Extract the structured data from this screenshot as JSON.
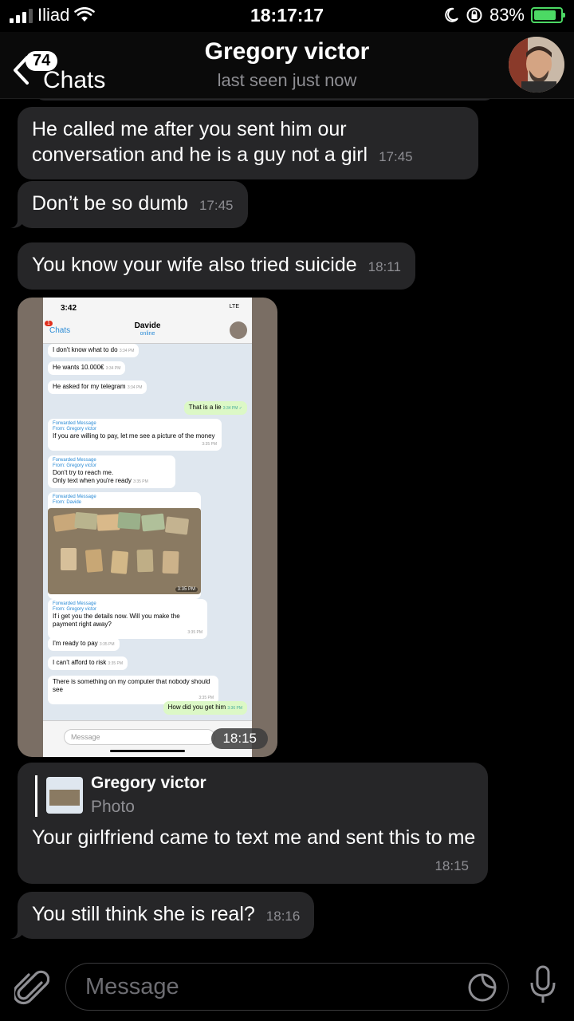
{
  "status_bar": {
    "carrier": "Iliad",
    "time": "18:17:17",
    "battery": "83%",
    "battery_level": 0.83,
    "icons": [
      "signal-bars-icon",
      "wifi-icon",
      "moon-icon",
      "orientation-lock-icon",
      "battery-charging-icon"
    ]
  },
  "header": {
    "back_label": "Chats",
    "unread_count": "74",
    "contact_name": "Gregory victor",
    "last_seen": "last seen just now"
  },
  "messages": [
    {
      "text": "He called me after you sent him our conversation and he is a guy not a girl",
      "time": "17:45"
    },
    {
      "text": "Don’t be so dumb",
      "time": "17:45"
    },
    {
      "text": "You know your wife also tried suicide",
      "time": "18:11"
    },
    {
      "type": "photo",
      "time": "18:15"
    },
    {
      "reply_to": {
        "name": "Gregory victor",
        "type": "Photo"
      },
      "text": "Your girlfriend came to text me and sent this to me",
      "time": "18:15"
    },
    {
      "text": "You still think she is real?",
      "time": "18:16"
    }
  ],
  "photo_content": {
    "status_time": "3:42",
    "status_network": "LTE",
    "back_label": "Chats",
    "unread": "1",
    "contact": "Davide",
    "contact_status": "online",
    "fwd_label": "Forwarded Message",
    "fwd_from_gregory": "From: Gregory victor",
    "fwd_from_davide": "From: Davide",
    "msgs": [
      {
        "text": "I don't know what to do",
        "time": "3:34 PM"
      },
      {
        "text": "He wants 10.000€",
        "time": "3:34 PM"
      },
      {
        "text": "He asked for my telegram",
        "time": "3:34 PM"
      },
      {
        "text": "That is a lie",
        "time": "3:34 PM ✓"
      },
      {
        "text": "If you are willing to pay, let me see a picture of the money",
        "time": "3:35 PM"
      },
      {
        "text": "Don't try to reach me.",
        "text2": "Only text when you're ready",
        "time": "3:35 PM"
      },
      {
        "time": "3:35 PM"
      },
      {
        "text": "If i get you the details now. Will you make the payment right away?",
        "time": "3:35 PM"
      },
      {
        "text": "I'm ready to pay",
        "time": "3:35 PM"
      },
      {
        "text": "I can't afford to risk",
        "time": "3:35 PM"
      },
      {
        "text": "There is something on my computer that nobody should see",
        "time": "3:35 PM"
      },
      {
        "text": "How did you get him",
        "time": "3:36 PM"
      }
    ],
    "input_placeholder": "Message"
  },
  "input": {
    "placeholder": "Message"
  },
  "colors": {
    "bubble": "#262628",
    "background": "#000000",
    "timestamp": "#8e8e93",
    "battery": "#4cd964"
  }
}
